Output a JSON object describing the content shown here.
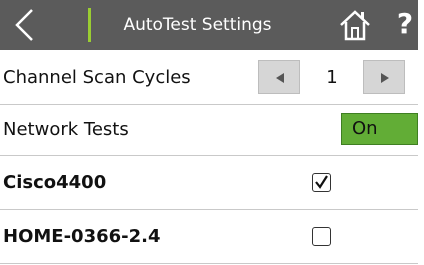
{
  "header": {
    "title": "AutoTest Settings",
    "back_icon": "chevron-left-icon",
    "home_icon": "home-icon",
    "help_label": "?"
  },
  "rows": {
    "channel_scan": {
      "label": "Channel Scan Cycles",
      "value": "1"
    },
    "network_tests": {
      "label": "Network Tests",
      "toggle": "On"
    },
    "networks": [
      {
        "name": "Cisco4400",
        "checked": true
      },
      {
        "name": "HOME-0366-2.4",
        "checked": false
      }
    ]
  },
  "colors": {
    "header_bg": "#5b5b5b",
    "accent": "#9acd32",
    "toggle_on": "#62ad36"
  }
}
